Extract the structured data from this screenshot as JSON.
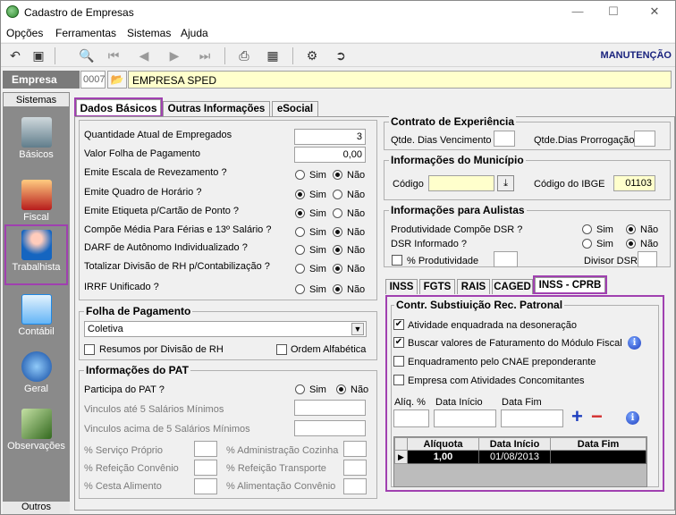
{
  "window": {
    "title": "Cadastro de Empresas"
  },
  "menu": {
    "items": [
      "Opções",
      "Ferramentas",
      "Sistemas",
      "Ajuda"
    ]
  },
  "toolbar": {
    "mode": "MANUTENÇÃO"
  },
  "empresa": {
    "label": "Empresa",
    "code": "0007",
    "name": "EMPRESA SPED"
  },
  "sidebar": {
    "header": "Sistemas",
    "footer": "Outros",
    "items": [
      {
        "label": "Básicos",
        "icon": "basicos-icon"
      },
      {
        "label": "Fiscal",
        "icon": "fiscal-icon"
      },
      {
        "label": "Trabalhista",
        "icon": "trabalhista-icon",
        "selected": true
      },
      {
        "label": "Contábil",
        "icon": "contabil-icon"
      },
      {
        "label": "Geral",
        "icon": "geral-icon"
      },
      {
        "label": "Observações",
        "icon": "observacoes-icon"
      }
    ]
  },
  "tabs": [
    "Dados Básicos",
    "Outras Informações",
    "eSocial"
  ],
  "dados": {
    "qtd_empregados_label": "Quantidade Atual de Empregados",
    "qtd_empregados": "3",
    "valor_folha_label": "Valor Folha de Pagamento",
    "valor_folha": "0,00",
    "rows": [
      {
        "label": "Emite Escala de Revezamento ?",
        "value": "Não"
      },
      {
        "label": "Emite Quadro de Horário ?",
        "value": "Sim"
      },
      {
        "label": "Emite Etiqueta p/Cartão de Ponto ?",
        "value": "Sim"
      },
      {
        "label": "Compõe Média Para Férias e 13º Salário ?",
        "value": "Não"
      },
      {
        "label": "DARF de Autônomo Individualizado ?",
        "value": "Não"
      },
      {
        "label": "Totalizar Divisão de RH p/Contabilização ?",
        "value": "Não"
      },
      {
        "label": "IRRF Unificado ?",
        "value": "Não"
      }
    ],
    "sim": "Sim",
    "nao": "Não"
  },
  "folha": {
    "title": "Folha de Pagamento",
    "value": "Coletiva",
    "resumos": "Resumos por Divisão de RH",
    "ordem": "Ordem Alfabética"
  },
  "pat": {
    "title": "Informações do PAT",
    "participa_label": "Participa do PAT ?",
    "participa": "Não",
    "ate5": "Vinculos até 5 Salários Mínimos",
    "acima5": "Vinculos acima de 5 Salários Mínimos",
    "servico": "% Serviço Próprio",
    "refeicao": "% Refeição Convênio",
    "cesta": "% Cesta Alimento",
    "adm_cozinha": "% Administração Cozinha",
    "ref_transporte": "% Refeição Transporte",
    "alim_convenio": "% Alimentação Convênio"
  },
  "contrato": {
    "title": "Contrato de Experiência",
    "dias_venc": "Qtde. Dias Vencimento",
    "dias_prorrog": "Qtde.Dias Prorrogação"
  },
  "municipio": {
    "title": "Informações do Município",
    "codigo_label": "Código",
    "ibge_label": "Código do IBGE",
    "ibge": "01103"
  },
  "aulistas": {
    "title": "Informações para Aulistas",
    "dsr_label": "Produtividade Compõe DSR ?",
    "dsr": "Não",
    "dsr_inf_label": "DSR Informado ?",
    "dsr_inf": "Não",
    "perc_prod": "% Produtividade",
    "divisor": "Divisor DSR"
  },
  "subtabs": [
    "INSS",
    "FGTS",
    "RAIS",
    "CAGED",
    "INSS - CPRB"
  ],
  "cprb": {
    "title": "Contr. Substiuição Rec. Patronal",
    "opts": [
      {
        "label": "Atividade enquadrada na desoneração",
        "checked": true
      },
      {
        "label": "Buscar valores de Faturamento do Módulo Fiscal",
        "checked": true
      },
      {
        "label": "Enquadramento pelo CNAE preponderante",
        "checked": false
      },
      {
        "label": "Empresa com Atividades Concomitantes",
        "checked": false
      }
    ],
    "aliq_label": "Alíq. %",
    "data_ini_label": "Data Início",
    "data_fim_label": "Data Fim",
    "grid": {
      "headers": [
        "Alíquota",
        "Data Início",
        "Data Fim"
      ],
      "rows": [
        {
          "aliquota": "1,00",
          "data_inicio": "01/08/2013",
          "data_fim": ""
        }
      ]
    }
  }
}
